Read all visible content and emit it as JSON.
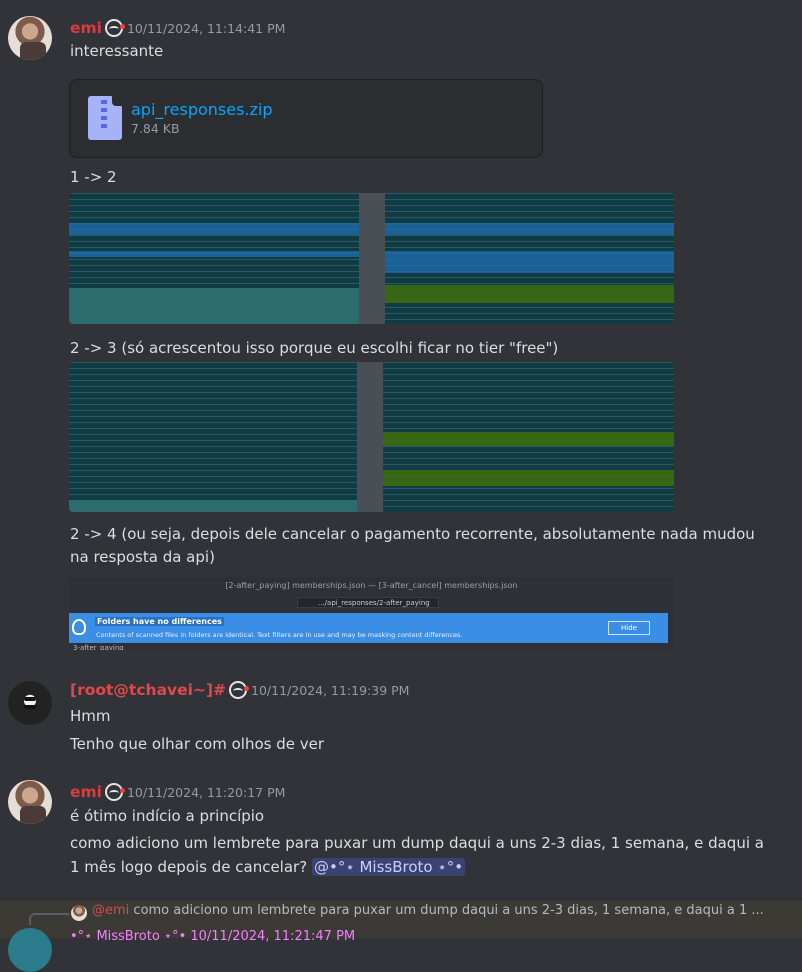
{
  "messages": [
    {
      "username": "emi",
      "username_color": "#d83c3e",
      "timestamp": "10/11/2024, 11:14:41 PM",
      "lines": [
        "interessante"
      ],
      "attachment": {
        "name": "api_responses.zip",
        "size": "7.84 KB",
        "icon": "zip-file-icon"
      },
      "captions": [
        "1 -> 2",
        "2 -> 3 (só acrescentou isso porque eu escolhi ficar no tier \"free\")",
        "2 -> 4 (ou seja, depois dele cancelar o pagamento recorrente, absolutamente nada mudou",
        "na resposta da api)"
      ],
      "diff_window": {
        "title": "[2-after_paying] memberships.json — [3-after_cancel] memberships.json",
        "path": ".../api_responses/2-after_paying",
        "banner_heading": "Folders have no differences",
        "banner_text": "Contents of scanned files in folders are identical. Text filters are in use and may be masking content differences.",
        "hide_label": "Hide",
        "footer": "3-after_paying"
      }
    },
    {
      "username": "[root@tchavei~]#",
      "username_color": "#e0484d",
      "timestamp": "10/11/2024, 11:19:39 PM",
      "lines": [
        "Hmm",
        "Tenho que olhar com olhos de ver"
      ]
    },
    {
      "username": "emi",
      "username_color": "#d83c3e",
      "timestamp": "10/11/2024, 11:20:17 PM",
      "lines": [
        "é ótimo indício a princípio",
        "como adiciono um lembrete para puxar um dump daqui a uns 2-3 dias, 1 semana, e daqui a",
        "1 mês logo depois de cancelar?"
      ],
      "mention": "@•°⋆ MissBroto ⋆°•"
    }
  ],
  "reply": {
    "author": "@emi",
    "text": "como adiciono um lembrete para puxar um dump daqui a uns 2-3 dias, 1 semana, e daqui a 1 ..."
  },
  "next_message": {
    "header": "•°⋆ MissBroto ⋆°•  10/11/2024, 11:21:47 PM"
  }
}
